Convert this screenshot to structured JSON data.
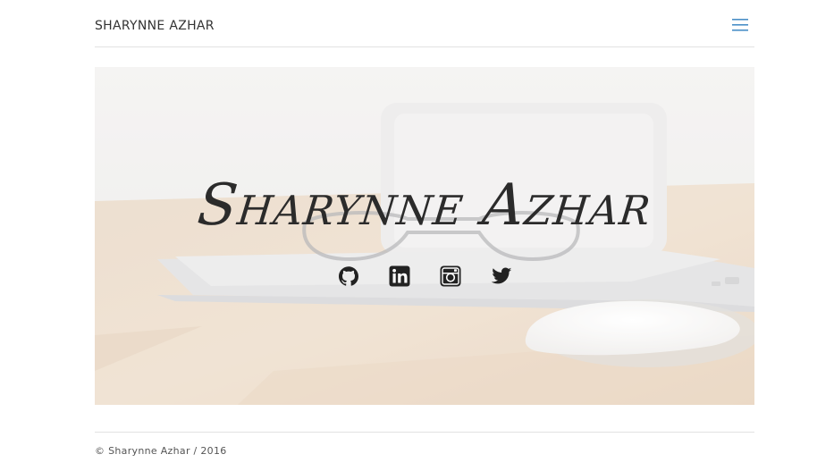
{
  "header": {
    "site_title": "SHARYNNE AZHAR",
    "menu_icon": "hamburger-menu-icon"
  },
  "hero": {
    "title": "Sharynne Azhar",
    "background": "faded photo of laptop, glasses and mouse on wooden desk",
    "social_links": [
      {
        "name": "github",
        "icon": "github-icon"
      },
      {
        "name": "linkedin",
        "icon": "linkedin-icon"
      },
      {
        "name": "instagram",
        "icon": "instagram-icon"
      },
      {
        "name": "twitter",
        "icon": "twitter-icon"
      }
    ]
  },
  "footer": {
    "copyright": "© Sharynne Azhar / 2016"
  },
  "colors": {
    "accent": "#4a8fc7",
    "text": "#333333",
    "rule": "#e2e2e2",
    "icon": "#222222"
  }
}
